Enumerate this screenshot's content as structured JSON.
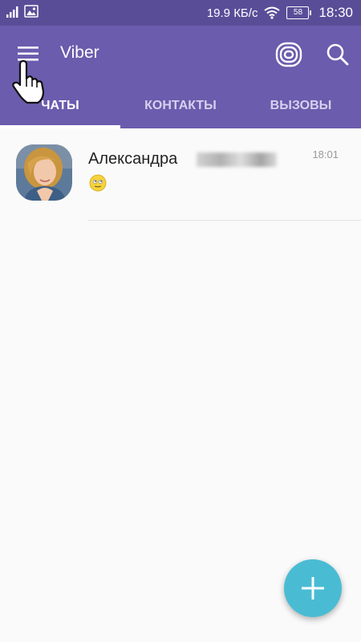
{
  "status_bar": {
    "network_speed": "19.9 КБ/с",
    "battery_level": "58",
    "time": "18:30",
    "icons": [
      "signal-icon",
      "image-notification-icon",
      "wifi-icon",
      "battery-icon"
    ]
  },
  "app_bar": {
    "title": "Viber",
    "icons": [
      "menu-icon",
      "viber-out-icon",
      "search-icon"
    ]
  },
  "tabs": [
    {
      "label": "ЧАТЫ",
      "active": true
    },
    {
      "label": "КОНТАКТЫ",
      "active": false
    },
    {
      "label": "ВЫЗОВЫ",
      "active": false
    }
  ],
  "chats": [
    {
      "name": "Александра",
      "time": "18:01",
      "preview_icon": "smiley-emoji-icon"
    }
  ],
  "fab": {
    "icon": "plus-icon"
  },
  "colors": {
    "status_bar": "#5a4d98",
    "app_bar": "#6b5cad",
    "tab_inactive": "#d7d1ee",
    "fab": "#49bcd3",
    "background": "#fafafa"
  }
}
